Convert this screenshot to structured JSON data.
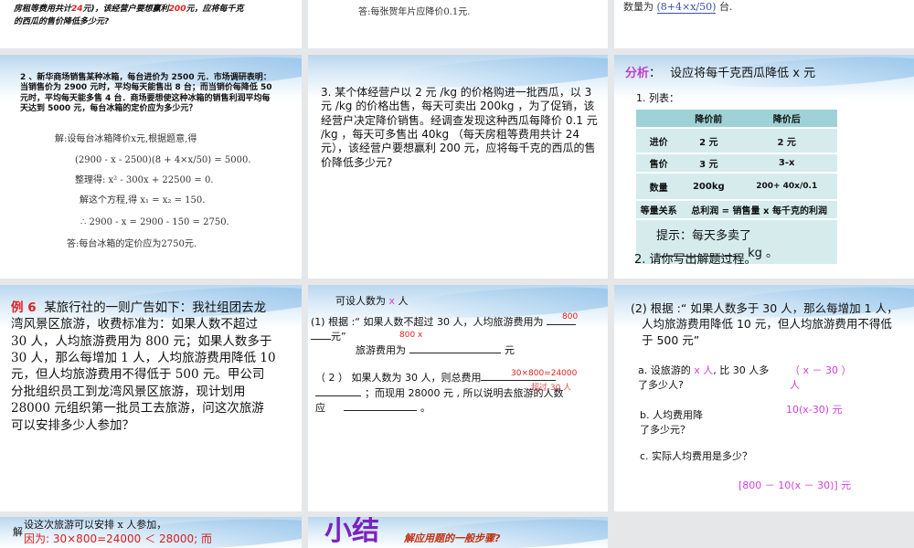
{
  "top_row": {
    "s1_text": "房租等费用共计",
    "s1_n1": "24",
    "s1_mid": "元)，该经营户要想赢利",
    "s1_n2": "200",
    "s1_end": "元，应将每千克",
    "s1_line2": "的西瓜的售价降低多少元?",
    "s2_answer": "答:每张贺年片应降价0.1元.",
    "s3_text": "数量为",
    "s3_formula": "(8+4×x/50)",
    "s3_unit": "台."
  },
  "slide_fridge": {
    "problem": "2 、新华商场销售某种冰箱，每台进价为 2500 元．市场调研表明：当销售价为 2900 元时，平均每天能售出 8 台；而当销价每降低 50 元时，平均每天能多售 4 台．商场要想使这种冰箱的销售利润平均每天达到 5000 元，每台冰箱的定价应为多少元？",
    "l1": "解:设每台冰箱降价x元,根据题意,得",
    "l2": "(2900 - x - 2500)(8 + 4×x/50) = 5000.",
    "l3": "整理得: x² - 300x + 22500 = 0.",
    "l4": "解这个方程,得  x₁ = x₂ = 150.",
    "l5": "∴ 2900 - x = 2900 - 150 = 2750.",
    "l6": "答:每台冰箱的定价应为2750元."
  },
  "slide_melon": {
    "problem": "3. 某个体经营户以 2 元 /kg 的价格购进一批西瓜，以 3 元 /kg 的价格出售，每天可卖出 200kg ，为了促销，该经营户决定降价销售。经调查发现这种西瓜每降价 0.1 元 /kg ，每天可多售出 40kg （每天房租等费用共计 24 元），该经营户要想赢利 200 元，应将每千克的西瓜的售价降低多少元?"
  },
  "slide_analysis": {
    "label": "分析",
    "title": "设应将每千克西瓜降低 x 元",
    "step1": "1. 列表：",
    "headers": [
      "",
      "降价前",
      "降价后"
    ],
    "rows": [
      [
        "进价",
        "2 元",
        "2 元"
      ],
      [
        "售价",
        "3 元",
        "3-x"
      ],
      [
        "数量",
        "200kg",
        "200+ 40x/0.1"
      ]
    ],
    "relation_label": "等量关系",
    "relation": "总利润 = 销售量 x 每千克的利润",
    "hint": "提示：每天多卖了",
    "hint_unit": "kg 。",
    "step2": "2. 请你写出解题过程。"
  },
  "slide_ex6": {
    "label": "例 6",
    "text": "某旅行社的一则广告如下：我社组团去龙湾风景区旅游，收费标准为：如果人数不超过 30 人，人均旅游费用为 800 元；如果人数多于 30 人，那么每增加 1 人，人均旅游费用降低 10 元，但人均旅游费用不得低于 500 元。甲公司分批组织员工到龙湾风景区旅游，现计划用 28000 元组织第一批员工去旅游，问这次旅游可以安排多少人参加？"
  },
  "slide_part1": {
    "l0a": "可设人数为",
    "l0x": "x",
    "l0b": "人",
    "l1": "(1) 根据 :“ 如果人数不超过 30 人，人均旅游费用为",
    "ans1": "800",
    "l1b": "元”",
    "ans2": "800 x",
    "l2": "旅游费用为",
    "l2u": "元",
    "l3": "（ 2 ）   如果人数为 30 人，则总费用",
    "ans3": "30×800=24000",
    "l4": "；而现用 28000 元 , 所以说明去旅游的人数",
    "ans4": "超过 30 人",
    "l5": "应",
    "l5end": "。"
  },
  "slide_part2": {
    "intro": "(2) 根据 :“ 如果人数多于 30 人，那么每增加 1 人，人均旅游费用降低 10 元，但人均旅游费用不得低于 500 元”",
    "a_q1": "a. 设旅游的",
    "a_x": "x 人",
    "a_q2": ", 比 30 人多了多少人?",
    "a_ans": "（ x － 30 ）人",
    "b_q": "b. 人均费用降了多少元？",
    "b_ans": "10(x-30) 元",
    "c_q": "c. 实际人均费用是多少？",
    "c_ans": "[800 － 10(x － 30)] 元"
  },
  "slide_solution": {
    "jie": "解",
    "l1": "设这次旅游可以安排 x 人参加，",
    "l2": "因为:  30×800=24000 ＜ 28000; 而"
  },
  "slide_summary": {
    "title": "小结",
    "subtitle": "解应用题的一般步骤?"
  }
}
